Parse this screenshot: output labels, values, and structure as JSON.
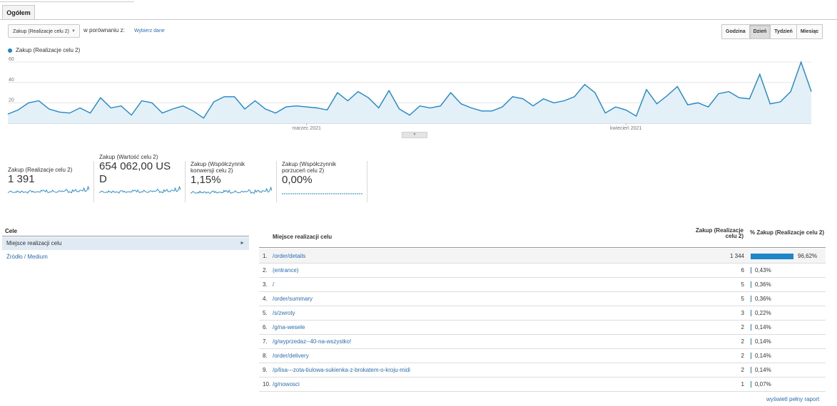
{
  "tab": "Ogółem",
  "controls": {
    "metric": "Zakup (Realizacje celu 2)",
    "compare_label": "w porównaniu z:",
    "choose_metric": "Wybierz dane",
    "granularity": [
      "Godzina",
      "Dzień",
      "Tydzień",
      "Miesiąc"
    ],
    "active_granularity": "Dzień"
  },
  "chart_data": {
    "type": "area",
    "series": [
      {
        "name": "Zakup (Realizacje celu 2)",
        "values": [
          9,
          13,
          20,
          22,
          14,
          11,
          10,
          15,
          10,
          25,
          15,
          17,
          8,
          22,
          20,
          10,
          14,
          17,
          12,
          5,
          21,
          26,
          26,
          14,
          22,
          14,
          10,
          16,
          17,
          16,
          15,
          13,
          30,
          22,
          31,
          25,
          15,
          32,
          14,
          8,
          17,
          15,
          17,
          30,
          19,
          15,
          12,
          12,
          16,
          26,
          24,
          17,
          24,
          20,
          22,
          26,
          38,
          30,
          10,
          16,
          13,
          7,
          33,
          19,
          27,
          36,
          18,
          20,
          16,
          29,
          31,
          25,
          24,
          48,
          19,
          21,
          31,
          60,
          31
        ],
        "color": "#1f87c7"
      }
    ],
    "y_ticks": [
      20,
      40,
      60
    ],
    "ylim": [
      0,
      65
    ],
    "x_labels": [
      {
        "label": "marzec 2021",
        "index": 29
      },
      {
        "label": "kwiecień 2021",
        "index": 60
      }
    ]
  },
  "scorecards": [
    {
      "label": "Zakup (Realizacje celu 2)",
      "value": "1 391"
    },
    {
      "label": "Zakup (Wartość celu 2)",
      "value": "654 062,00 USD"
    },
    {
      "label": "Zakup (Współczynnik konwersji celu 2)",
      "value": "1,15%"
    },
    {
      "label": "Zakup (Współczynnik porzuceń celu 2)",
      "value": "0,00%"
    }
  ],
  "goals": {
    "title": "Cele",
    "items": [
      "Miejsce realizacji celu",
      "Źródło / Medium"
    ]
  },
  "table": {
    "col1": "Miejsce realizacji celu",
    "col2": "Zakup (Realizacje celu 2)",
    "col3": "% Zakup (Realizacje celu 2)",
    "rows": [
      {
        "num": "1.",
        "page": "/order/details",
        "value": "1 344",
        "pct": "96,62%",
        "fraction": 0.9662
      },
      {
        "num": "2.",
        "page": "(entrance)",
        "value": "6",
        "pct": "0,43%",
        "fraction": 0.0043
      },
      {
        "num": "3.",
        "page": "/",
        "value": "5",
        "pct": "0,36%",
        "fraction": 0.0036
      },
      {
        "num": "4.",
        "page": "/order/summary",
        "value": "5",
        "pct": "0,36%",
        "fraction": 0.0036
      },
      {
        "num": "5.",
        "page": "/s/zwroty",
        "value": "3",
        "pct": "0,22%",
        "fraction": 0.0022
      },
      {
        "num": "6.",
        "page": "/g/na-wesele",
        "value": "2",
        "pct": "0,14%",
        "fraction": 0.0014
      },
      {
        "num": "7.",
        "page": "/g/wyprzedaz--40-na-wszystko!",
        "value": "2",
        "pct": "0,14%",
        "fraction": 0.0014
      },
      {
        "num": "8.",
        "page": "/order/delivery",
        "value": "2",
        "pct": "0,14%",
        "fraction": 0.0014
      },
      {
        "num": "9.",
        "page": "/p/lisa---zota-tiulowa-sukienka-z-brokatem-o-kroju-midi",
        "value": "2",
        "pct": "0,14%",
        "fraction": 0.0014
      },
      {
        "num": "10.",
        "page": "/g/nowosci",
        "value": "1",
        "pct": "0,07%",
        "fraction": 0.0007
      }
    ]
  },
  "full_report": "wyświetl pełny raport"
}
